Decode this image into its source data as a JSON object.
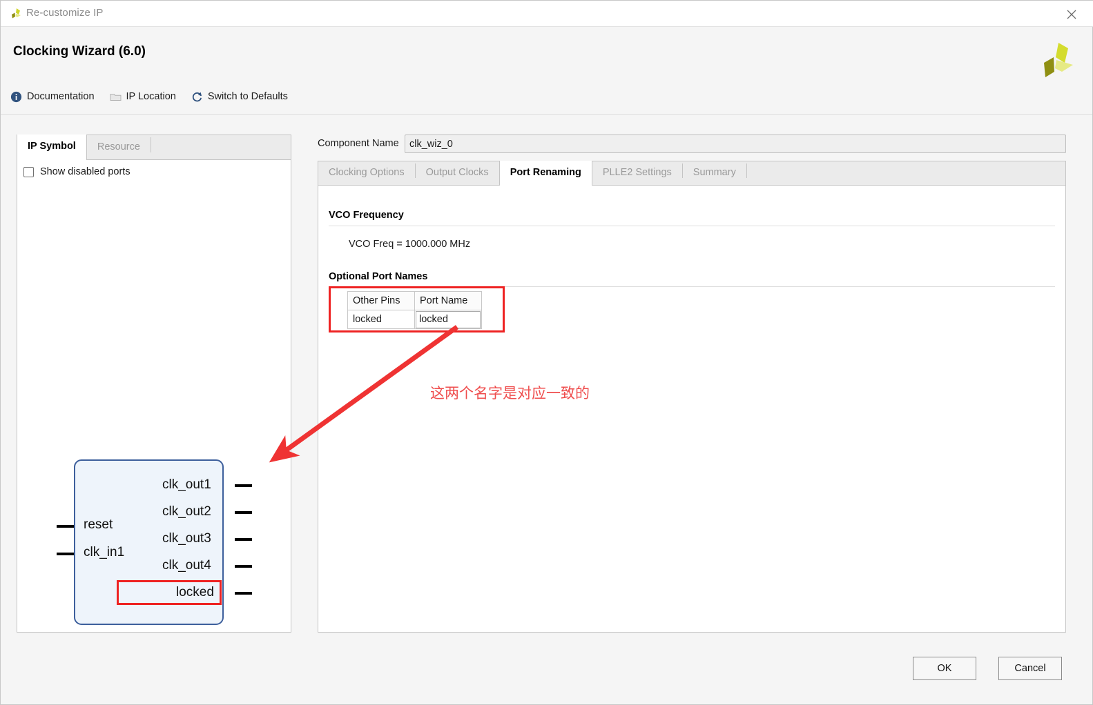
{
  "window": {
    "title": "Re-customize IP",
    "icon": "xilinx-logo-icon",
    "close_label": "close-icon"
  },
  "header": {
    "title": "Clocking Wizard (6.0)",
    "brand": "xilinx-logo",
    "toolbar": [
      {
        "label": "Documentation",
        "icon": "info-icon"
      },
      {
        "label": "IP Location",
        "icon": "folder-icon"
      },
      {
        "label": "Switch to Defaults",
        "icon": "refresh-icon"
      }
    ]
  },
  "left_panel": {
    "tabs": [
      {
        "label": "IP Symbol",
        "active": true
      },
      {
        "label": "Resource",
        "active": false
      }
    ],
    "show_disabled_ports": {
      "label": "Show disabled ports",
      "checked": false
    },
    "symbol": {
      "inputs": [
        "reset",
        "clk_in1"
      ],
      "outputs": [
        "clk_out1",
        "clk_out2",
        "clk_out3",
        "clk_out4",
        "locked"
      ],
      "highlighted_port": "locked",
      "fill_color": "#eef4fb",
      "border_color": "#3d5f9c"
    }
  },
  "component_name": {
    "label": "Component Name",
    "value": "clk_wiz_0"
  },
  "right_panel": {
    "tabs": [
      {
        "label": "Clocking Options",
        "active": false
      },
      {
        "label": "Output Clocks",
        "active": false
      },
      {
        "label": "Port Renaming",
        "active": true
      },
      {
        "label": "PLLE2 Settings",
        "active": false
      },
      {
        "label": "Summary",
        "active": false
      }
    ],
    "vco_section": {
      "heading": "VCO Frequency",
      "value_text": "VCO Freq = 1000.000 MHz"
    },
    "port_names_section": {
      "heading": "Optional Port Names",
      "columns": [
        "Other Pins",
        "Port Name"
      ],
      "rows": [
        {
          "other_pin": "locked",
          "port_name": "locked"
        }
      ]
    }
  },
  "annotation": {
    "text": "这两个名字是对应一致的",
    "color": "#ef4d4d"
  },
  "footer": {
    "ok_label": "OK",
    "cancel_label": "Cancel"
  }
}
